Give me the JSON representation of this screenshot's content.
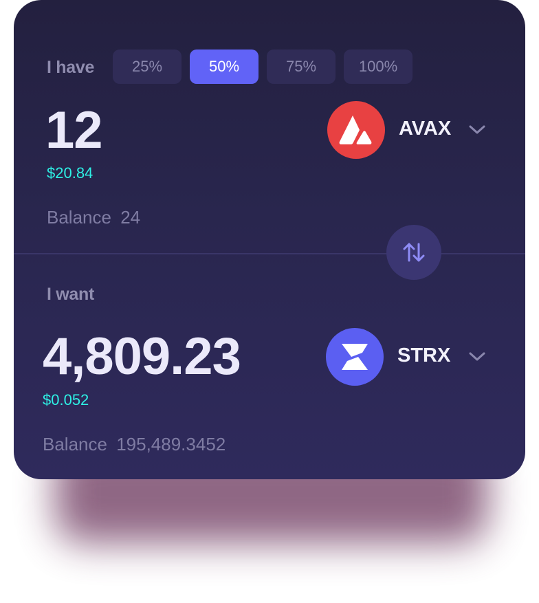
{
  "have": {
    "label": "I have",
    "percent_options": [
      "25%",
      "50%",
      "75%",
      "100%"
    ],
    "selected_percent": "50%",
    "amount": "12",
    "usd_value": "$20.84",
    "balance_label": "Balance",
    "balance_value": "24",
    "token": {
      "symbol": "AVAX",
      "icon": "avalanche-logo-icon",
      "color": "#e84142"
    }
  },
  "want": {
    "label": "I want",
    "amount": "4,809.23",
    "usd_value": "$0.052",
    "balance_label": "Balance",
    "balance_value": "195,489.3452",
    "token": {
      "symbol": "STRX",
      "icon": "strx-logo-icon",
      "color": "#5b5ff2"
    }
  },
  "swap": {
    "icon": "swap-arrows-icon"
  },
  "colors": {
    "accent": "#6163f7",
    "usd_text": "#2ef1e5",
    "card_bg": "#29264e"
  }
}
